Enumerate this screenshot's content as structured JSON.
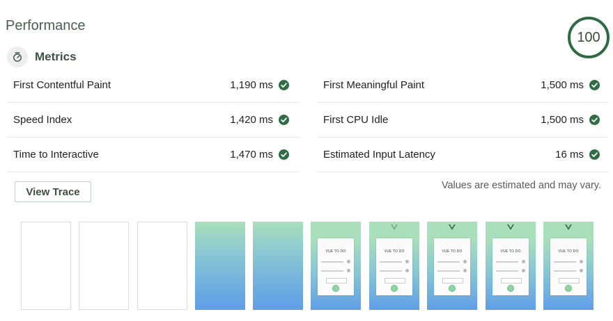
{
  "section_title": "Performance",
  "score": "100",
  "metrics_title": "Metrics",
  "metrics": [
    {
      "label": "First Contentful Paint",
      "value": "1,190 ms"
    },
    {
      "label": "First Meaningful Paint",
      "value": "1,500 ms"
    },
    {
      "label": "Speed Index",
      "value": "1,420 ms"
    },
    {
      "label": "First CPU Idle",
      "value": "1,500 ms"
    },
    {
      "label": "Time to Interactive",
      "value": "1,470 ms"
    },
    {
      "label": "Estimated Input Latency",
      "value": "16 ms"
    }
  ],
  "view_trace_label": "View Trace",
  "estimate_note": "Values are estimated and may vary.",
  "filmstrip": {
    "frames": [
      "blank",
      "blank",
      "blank",
      "gradient",
      "gradient",
      "app",
      "app",
      "app",
      "app",
      "app"
    ],
    "app_title": "VUE TO DO"
  },
  "colors": {
    "pass": "#2f6d44",
    "score_ring": "#2e6b45",
    "frame_top": "#a9dfba",
    "frame_bottom": "#5f9ee6"
  }
}
